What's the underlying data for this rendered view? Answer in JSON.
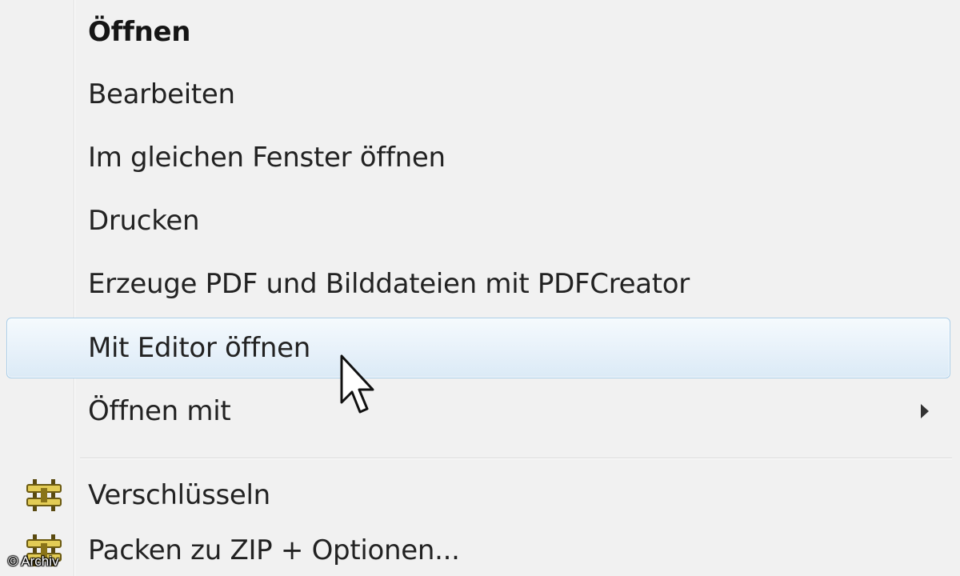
{
  "context_menu": {
    "items": [
      {
        "label": "Öffnen",
        "bold": true
      },
      {
        "label": "Bearbeiten"
      },
      {
        "label": "Im gleichen Fenster öffnen"
      },
      {
        "label": "Drucken"
      },
      {
        "label": "Erzeuge PDF und Bilddateien mit PDFCreator"
      },
      {
        "label": "Mit Editor öffnen",
        "highlighted": true
      },
      {
        "label": "Öffnen mit",
        "has_submenu": true
      },
      {
        "label": "Verschlüsseln",
        "icon": "encryption-archive-icon"
      },
      {
        "label": "Packen zu ZIP + Optionen...",
        "icon": "zip-archive-icon"
      }
    ]
  },
  "copyright": "© Archiv",
  "colors": {
    "menu_background": "#f1f1f1",
    "highlight_border": "#a9cde8",
    "highlight_fill": "#e7f1fa",
    "text": "#222222",
    "icon_gold": "#d9c24a"
  }
}
